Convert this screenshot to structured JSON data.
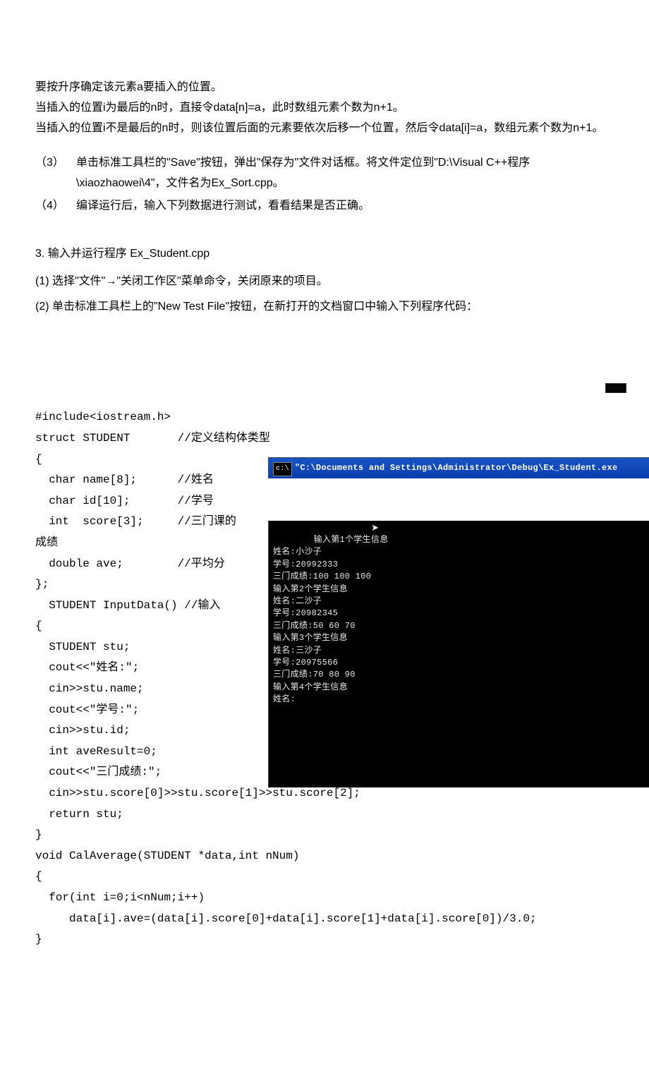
{
  "intro": {
    "p1": "要按升序确定该元素a要插入的位置。",
    "p2": "当插入的位置i为最后的n时，直接令data[n]=a，此时数组元素个数为n+1。",
    "p3": "当插入的位置i不是最后的n时，则该位置后面的元素要依次后移一个位置，然后令data[i]=a，数组元素个数为n+1。"
  },
  "items": {
    "n3": "（3）",
    "c3": "单击标准工具栏的\"Save\"按钮，弹出\"保存为\"文件对话框。将文件定位到\"D:\\Visual C++程序\\xiaozhaowei\\4\"，文件名为Ex_Sort.cpp。",
    "n4": "（4）",
    "c4": "编译运行后，输入下列数据进行测试，看看结果是否正确。"
  },
  "section3": {
    "heading": "3.  输入并运行程序 Ex_Student.cpp",
    "step1": "(1) 选择\"文件\"→\"关闭工作区\"菜单命令，关闭原来的项目。",
    "step2": "(2) 单击标准工具栏上的\"New Test File\"按钮，在新打开的文档窗口中输入下列程序代码："
  },
  "code": "#include<iostream.h>\nstruct STUDENT       //定义结构体类型\n{\n  char name[8];      //姓名\n  char id[10];       //学号\n  int  score[3];     //三门课的\n成绩\n  double ave;        //平均分\n};\n  STUDENT InputData() //输入\n{\n  STUDENT stu;\n  cout<<\"姓名:\";\n  cin>>stu.name;\n  cout<<\"学号:\";\n  cin>>stu.id;\n  int aveResult=0;\n  cout<<\"三门成绩:\";\n  cin>>stu.score[0]>>stu.score[1]>>stu.score[2];\n  return stu;\n}\nvoid CalAverage(STUDENT *data,int nNum)\n{\n  for(int i=0;i<nNum;i++)\n     data[i].ave=(data[i].score[0]+data[i].score[1]+data[i].score[0])/3.0;\n}",
  "console": {
    "title": "\"C:\\Documents and Settings\\Administrator\\Debug\\Ex_Student.exe",
    "cmd_icon_text": "c:\\",
    "body": "输入第1个学生信息\n姓名:小沙子\n学号:20992333\n三门成绩:100 100 100\n输入第2个学生信息\n姓名:二沙子\n学号:20982345\n三门成绩:50 60 70\n输入第3个学生信息\n姓名:三沙子\n学号:20975566\n三门成绩:70 80 90\n输入第4个学生信息\n姓名:"
  }
}
